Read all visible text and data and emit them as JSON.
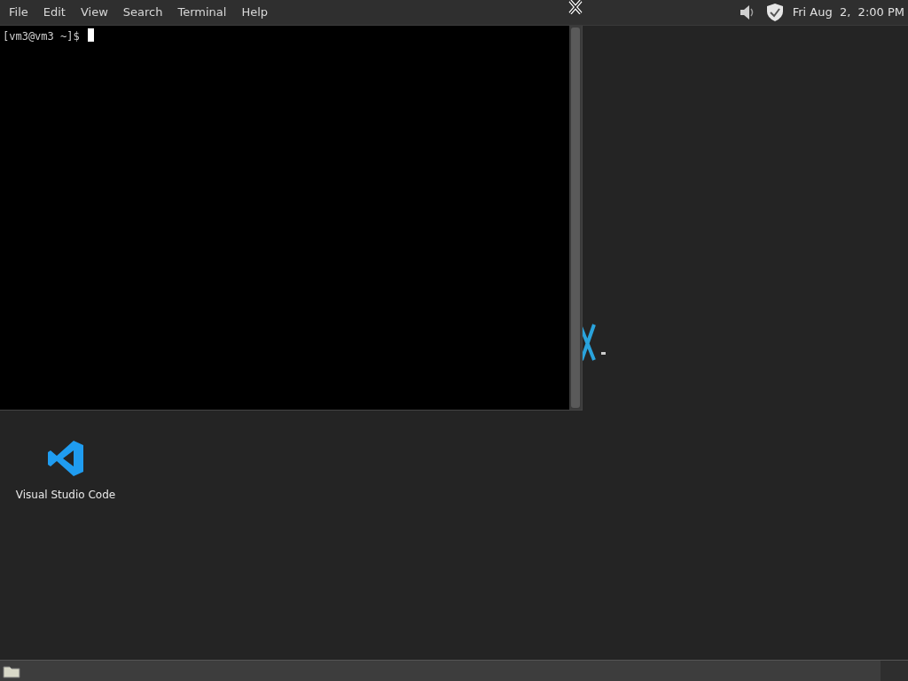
{
  "menu": [
    "File",
    "Edit",
    "View",
    "Search",
    "Terminal",
    "Help"
  ],
  "terminal": {
    "prompt": "[vm3@vm3 ~]$"
  },
  "tray": {
    "clock": "Fri Aug  2,  2:00 PM"
  },
  "desktop_icons": [
    {
      "label": "Visual Studio Code",
      "kind": "vscode"
    }
  ]
}
